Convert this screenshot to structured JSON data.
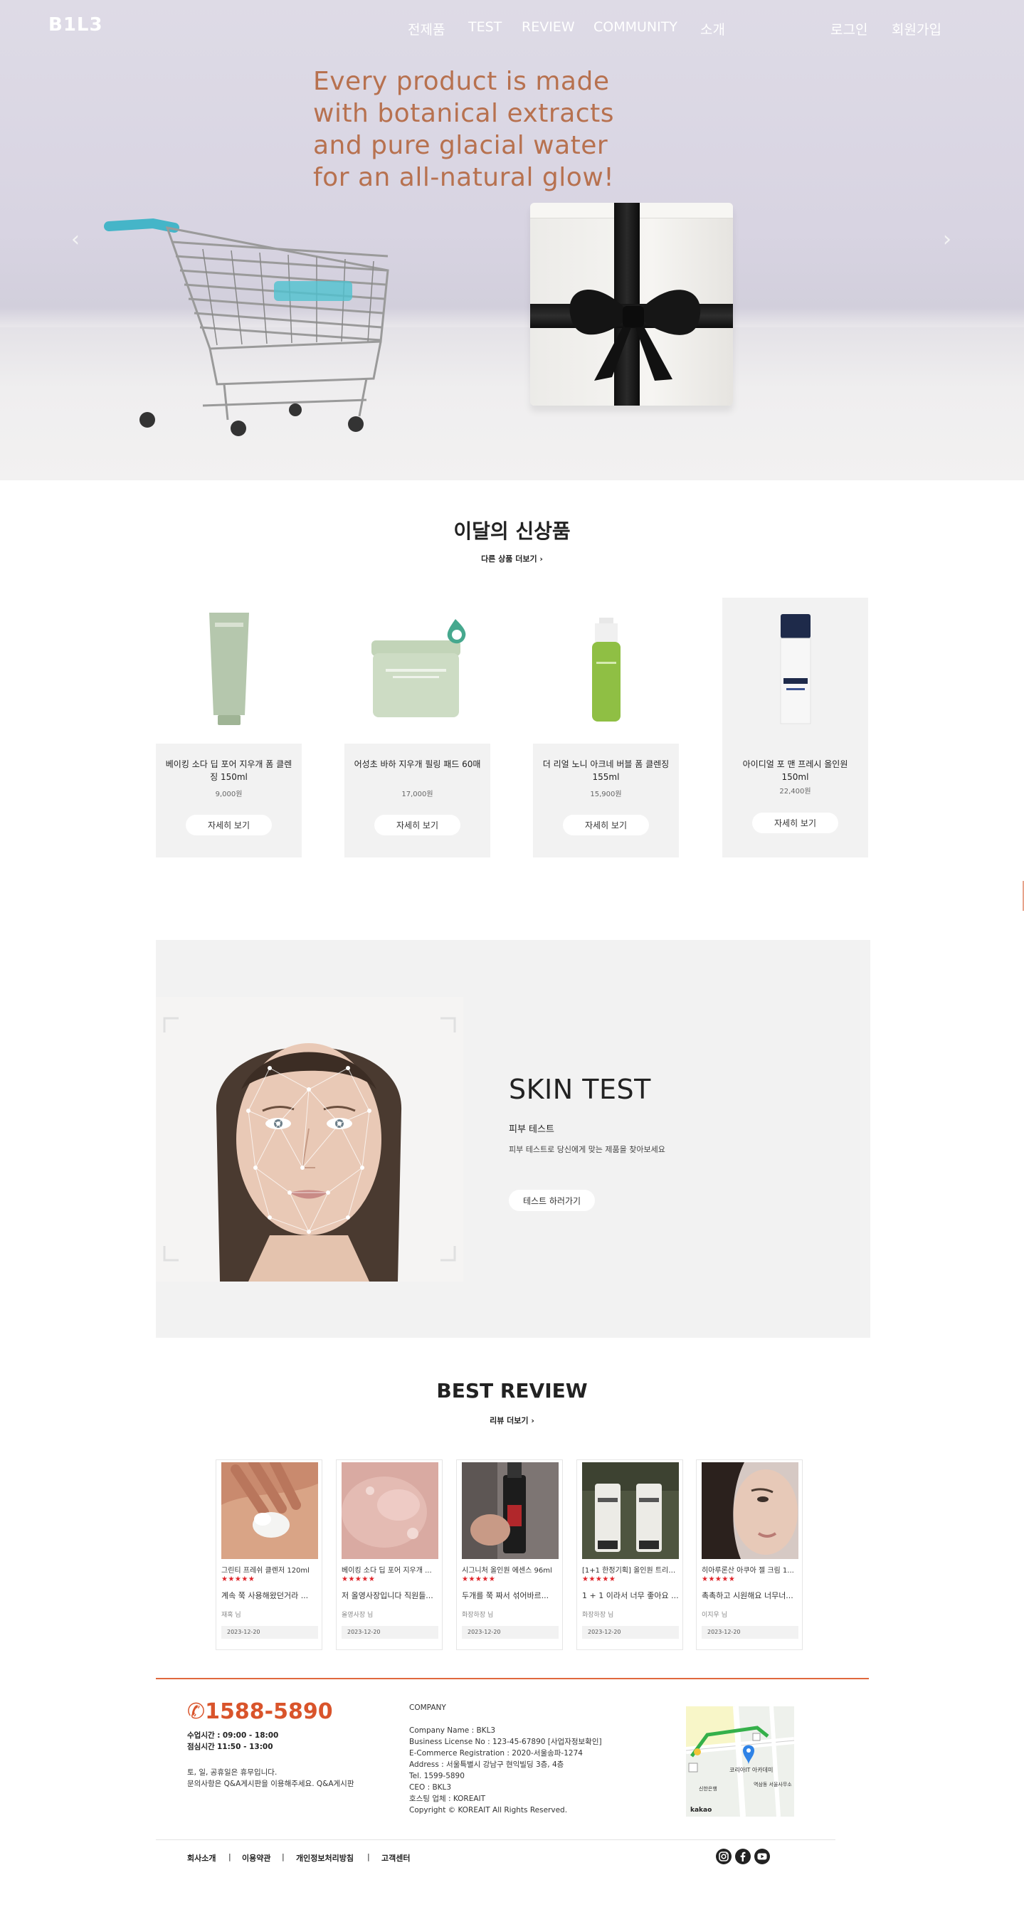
{
  "brand": "B1L3",
  "nav": {
    "menu": [
      "전제품",
      "TEST",
      "REVIEW",
      "COMMUNITY",
      "소개"
    ],
    "login": "로그인",
    "signup": "회원가입"
  },
  "hero": {
    "lines": [
      "Every product is made",
      "with botanical extracts",
      "and pure glacial water",
      "for an all-natural glow!"
    ],
    "prev_arrow": "‹",
    "next_arrow": "›"
  },
  "new_products": {
    "title": "이달의 신상품",
    "more_link": "다른 상품 더보기 ›",
    "items": [
      {
        "name": "베이킹 소다 딥 포어 지우개 폼 클렌징 150ml",
        "price": "9,000원",
        "button": "자세히 보기"
      },
      {
        "name": "어성초 바하 지우개 필링 패드 60매",
        "price": "17,000원",
        "button": "자세히 보기"
      },
      {
        "name": "더 리얼 노니 아크네 버블 폼 클렌징 155ml",
        "price": "15,900원",
        "button": "자세히 보기"
      },
      {
        "name": "아이디얼 포 맨 프레시 올인원 150ml",
        "price": "22,400원",
        "button": "자세히 보기"
      }
    ]
  },
  "skin_test": {
    "title": "SKIN TEST",
    "subtitle": "피부 테스트",
    "description": "피부 테스트로 당신에게 맞는 제품을 찾아보세요",
    "button": "테스트 하러가기"
  },
  "best_review": {
    "title": "BEST REVIEW",
    "more_link": "리뷰 더보기 ›",
    "items": [
      {
        "product": "그린티 프레쉬 클렌저 120ml",
        "stars": "★★★★★",
        "text": "계속 쭉 사용해왔던거라 ...",
        "author": "재혹 님",
        "date": "2023-12-20"
      },
      {
        "product": "베이킹 소다 딥 포어 지우개 ...",
        "stars": "★★★★★",
        "text": "저 올영사장입니다 직원들...",
        "author": "올영사장 님",
        "date": "2023-12-20"
      },
      {
        "product": "시그니처 올인원 에센스 96ml",
        "stars": "★★★★★",
        "text": "두개를 쭉 짜서 섞어바르...",
        "author": "화장하장 님",
        "date": "2023-12-20"
      },
      {
        "product": "[1+1 한정기획] 올인원 트리트...",
        "stars": "★★★★★",
        "text": "1 + 1 이라서 너무 좋아요 ...",
        "author": "화장하장 님",
        "date": "2023-12-20"
      },
      {
        "product": "히아루론산 아쿠아 젤 크림 1...",
        "stars": "★★★★★",
        "text": "촉촉하고 시원해요 너무너...",
        "author": "이지우 님",
        "date": "2023-12-20"
      }
    ]
  },
  "footer": {
    "phone": "1588-5890",
    "hours_label": "수업시간 :",
    "hours_value": "09:00 - 18:00",
    "lunch_label": "점심시간",
    "lunch_value": "11:50 - 13:00",
    "holiday": "토, 일, 공휴일은 휴무입니다.",
    "inquiry": "문의사항은 Q&A게시판을 이용해주세요. Q&A게시판",
    "company_heading": "COMPANY",
    "company_lines": [
      "Company Name : BKL3",
      "Business License No : 123-45-67890 [사업자정보확인]",
      "E-Commerce Registration : 2020-서울송파-1274",
      "Address : 서울특별시 강남구 현익빌딩 3층, 4층",
      "Tel. 1599-5890",
      "CEO : BKL3",
      "호스팅 업체 : KOREAIT",
      "Copyright © KOREAIT All Rights Reserved."
    ],
    "map": {
      "place": "코리아IT 아카데미",
      "bank": "신한은행",
      "office": "역삼동 서울사무소",
      "brand": "kakao"
    },
    "links": [
      "회사소개",
      "이용약관",
      "개인정보처리방침",
      "고객센터"
    ],
    "separator": "|",
    "social": [
      "instagram-icon",
      "facebook-icon",
      "youtube-icon"
    ]
  }
}
